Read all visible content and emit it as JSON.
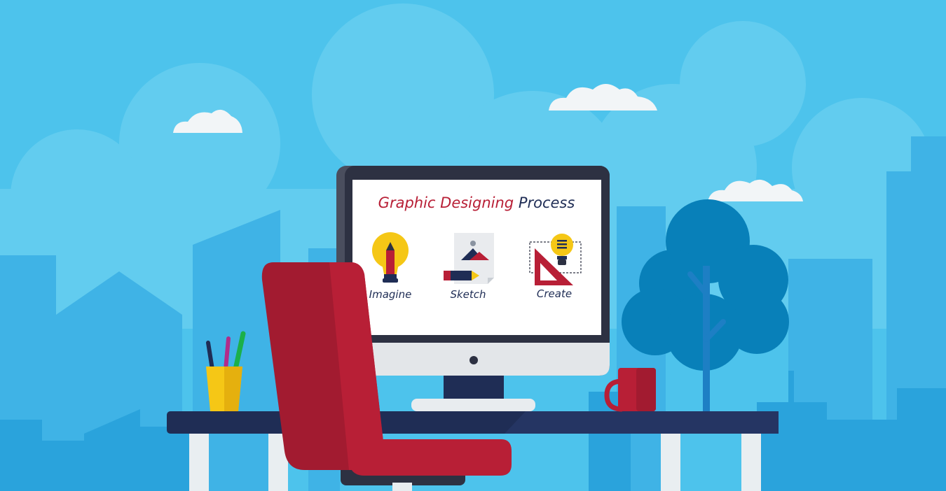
{
  "screen": {
    "title_part1": "Graphic Designing",
    "title_part2": "Process"
  },
  "steps": [
    {
      "label": "Imagine",
      "icon": "lightbulb-pencil-icon"
    },
    {
      "label": "Sketch",
      "icon": "image-sketch-pencil-icon"
    },
    {
      "label": "Create",
      "icon": "set-square-lightbulb-icon"
    }
  ],
  "colors": {
    "sky": "#4dc3ec",
    "accent_red": "#b81f36",
    "navy": "#1f2d55",
    "yellow": "#f5c716"
  }
}
